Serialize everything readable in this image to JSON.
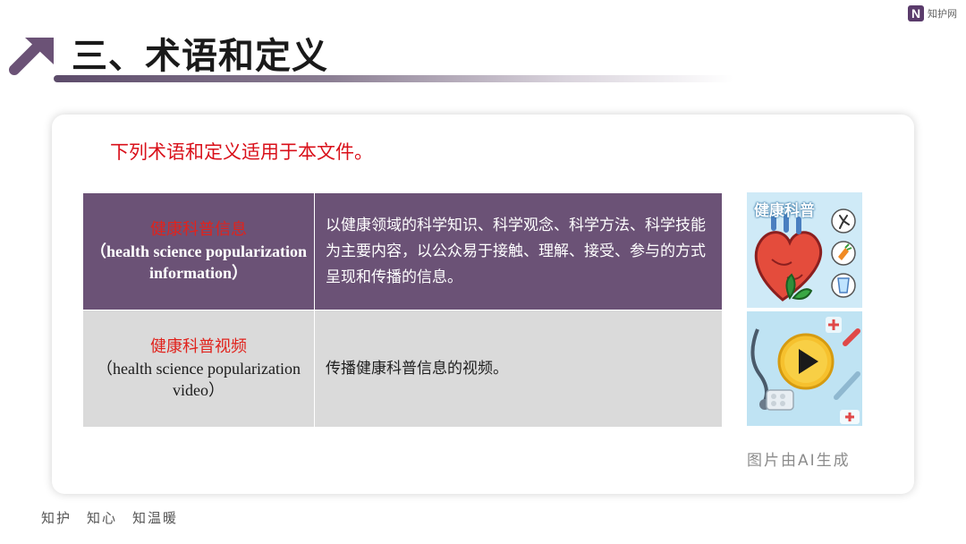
{
  "brand": {
    "logo_letter": "N",
    "logo_text": "知护网"
  },
  "page": {
    "title": "三、术语和定义"
  },
  "card": {
    "intro": "下列术语和定义适用于本文件。",
    "terms": [
      {
        "term_cn": "健康科普信息",
        "term_en": "（health science popularization information）",
        "definition": "以健康领域的科学知识、科学观念、科学方法、科学技能为主要内容，以公众易于接触、理解、接受、参与的方式呈现和传播的信息。"
      },
      {
        "term_cn": "健康科普视频",
        "term_en": "（health science popularization video）",
        "definition": "传播健康科普信息的视频。"
      }
    ],
    "image_top_title": "健康科普",
    "image_credit": "图片由AI生成"
  },
  "footer": {
    "slogan": "知护　知心　知温暖"
  },
  "colors": {
    "accent": "#6b5276",
    "highlight": "#d9101a",
    "row_light": "#dadada"
  }
}
